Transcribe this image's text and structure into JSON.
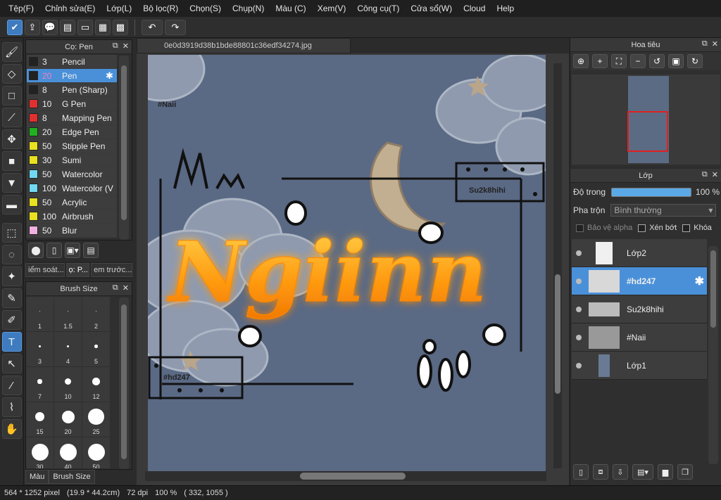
{
  "menu": [
    "Tệp(F)",
    "Chỉnh sửa(E)",
    "Lớp(L)",
    "Bộ lọc(R)",
    "Chọn(S)",
    "Chụp(N)",
    "Màu (C)",
    "Xem(V)",
    "Công cụ(T)",
    "Cửa sổ(W)",
    "Cloud",
    "Help"
  ],
  "brush_panel": {
    "title": "Cọ: Pen",
    "brushes": [
      {
        "size": "3",
        "name": "Pencil",
        "color": "#222222"
      },
      {
        "size": "20",
        "name": "Pen",
        "color": "#222222"
      },
      {
        "size": "8",
        "name": "Pen (Sharp)",
        "color": "#222222"
      },
      {
        "size": "10",
        "name": "G Pen",
        "color": "#e03030"
      },
      {
        "size": "8",
        "name": "Mapping Pen",
        "color": "#e03030"
      },
      {
        "size": "20",
        "name": "Edge Pen",
        "color": "#20b020"
      },
      {
        "size": "50",
        "name": "Stipple Pen",
        "color": "#e8e020"
      },
      {
        "size": "30",
        "name": "Sumi",
        "color": "#e8e020"
      },
      {
        "size": "50",
        "name": "Watercolor",
        "color": "#70d8f0"
      },
      {
        "size": "100",
        "name": "Watercolor (V",
        "color": "#70d8f0"
      },
      {
        "size": "50",
        "name": "Acrylic",
        "color": "#e8e020"
      },
      {
        "size": "100",
        "name": "Airbrush",
        "color": "#e8e020"
      },
      {
        "size": "50",
        "name": "Blur",
        "color": "#f0b0e0"
      }
    ],
    "tabs": [
      "iểm soát...",
      "ọ: P...",
      "em trước..."
    ]
  },
  "brush_size_panel": {
    "title": "Brush Size",
    "sizes": [
      "1",
      "1.5",
      "2",
      "3",
      "4",
      "5",
      "7",
      "10",
      "12",
      "15",
      "20",
      "25",
      "30",
      "40",
      "50"
    ]
  },
  "bottom_tabs": [
    "Màu",
    "Brush Size"
  ],
  "document": {
    "filename": "0e0d3919d38b1bde88801c36edf34274.jpg",
    "art_texts": {
      "main": "Ngiinn",
      "tag1": "#Naii",
      "tag2": "Su2k8hihi",
      "tag3": "#hd247"
    }
  },
  "navigator": {
    "title": "Hoa tiêu"
  },
  "layers": {
    "title": "Lớp",
    "opacity_label": "Độ trong",
    "opacity_value": "100 %",
    "opacity_fraction": 1.0,
    "blend_label": "Pha trộn",
    "blend_value": "Bình thường",
    "protect_alpha": "Bảo vệ alpha",
    "clipping": "Xén bớt",
    "lock": "Khóa",
    "items": [
      {
        "name": "Lớp2",
        "selected": false
      },
      {
        "name": "#hd247",
        "selected": true
      },
      {
        "name": "Su2k8hihi",
        "selected": false
      },
      {
        "name": "#Naii",
        "selected": false
      },
      {
        "name": "Lớp1",
        "selected": false
      }
    ]
  },
  "status": {
    "pixels": "564 * 1252 pixel",
    "cm": "(19.9 * 44.2cm)",
    "dpi": "72 dpi",
    "zoom": "100 %",
    "coords": "( 332, 1055 )"
  },
  "colors": {
    "accent": "#4a90d9",
    "nav_frame": "#e02020",
    "glow": "#ffa500"
  }
}
